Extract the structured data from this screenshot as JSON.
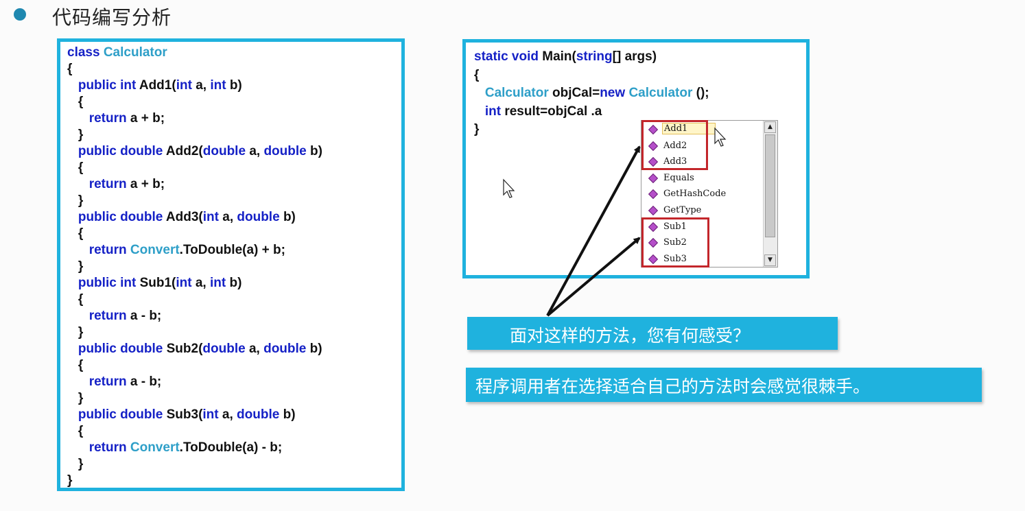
{
  "heading": "代码编写分析",
  "left_code": [
    {
      "segs": [
        [
          "kw",
          "class "
        ],
        [
          "ty",
          "Calculator"
        ]
      ]
    },
    {
      "segs": [
        [
          "",
          "{"
        ]
      ]
    },
    {
      "segs": [
        [
          "",
          "   "
        ],
        [
          "kw",
          "public int "
        ],
        [
          "",
          "Add1("
        ],
        [
          "kw",
          "int "
        ],
        [
          "",
          "a, "
        ],
        [
          "kw",
          "int "
        ],
        [
          "",
          "b)"
        ]
      ]
    },
    {
      "segs": [
        [
          "",
          "   {"
        ]
      ]
    },
    {
      "segs": [
        [
          "",
          "      "
        ],
        [
          "kw",
          "return "
        ],
        [
          "",
          "a + b;"
        ]
      ]
    },
    {
      "segs": [
        [
          "",
          "   }"
        ]
      ]
    },
    {
      "segs": [
        [
          "",
          "   "
        ],
        [
          "kw",
          "public double "
        ],
        [
          "",
          "Add2("
        ],
        [
          "kw",
          "double "
        ],
        [
          "",
          "a, "
        ],
        [
          "kw",
          "double "
        ],
        [
          "",
          "b)"
        ]
      ]
    },
    {
      "segs": [
        [
          "",
          "   {"
        ]
      ]
    },
    {
      "segs": [
        [
          "",
          "      "
        ],
        [
          "kw",
          "return "
        ],
        [
          "",
          "a + b;"
        ]
      ]
    },
    {
      "segs": [
        [
          "",
          "   }"
        ]
      ]
    },
    {
      "segs": [
        [
          "",
          "   "
        ],
        [
          "kw",
          "public double "
        ],
        [
          "",
          "Add3("
        ],
        [
          "kw",
          "int "
        ],
        [
          "",
          "a, "
        ],
        [
          "kw",
          "double "
        ],
        [
          "",
          "b)"
        ]
      ]
    },
    {
      "segs": [
        [
          "",
          "   {"
        ]
      ]
    },
    {
      "segs": [
        [
          "",
          "      "
        ],
        [
          "kw",
          "return "
        ],
        [
          "ty",
          "Convert"
        ],
        [
          "",
          ".ToDouble(a) + b;"
        ]
      ]
    },
    {
      "segs": [
        [
          "",
          "   }"
        ]
      ]
    },
    {
      "segs": [
        [
          "",
          "   "
        ],
        [
          "kw",
          "public int "
        ],
        [
          "",
          "Sub1("
        ],
        [
          "kw",
          "int "
        ],
        [
          "",
          "a, "
        ],
        [
          "kw",
          "int "
        ],
        [
          "",
          "b)"
        ]
      ]
    },
    {
      "segs": [
        [
          "",
          "   {"
        ]
      ]
    },
    {
      "segs": [
        [
          "",
          "      "
        ],
        [
          "kw",
          "return "
        ],
        [
          "",
          "a - b;"
        ]
      ]
    },
    {
      "segs": [
        [
          "",
          "   }"
        ]
      ]
    },
    {
      "segs": [
        [
          "",
          "   "
        ],
        [
          "kw",
          "public double "
        ],
        [
          "",
          "Sub2("
        ],
        [
          "kw",
          "double "
        ],
        [
          "",
          "a, "
        ],
        [
          "kw",
          "double "
        ],
        [
          "",
          "b)"
        ]
      ]
    },
    {
      "segs": [
        [
          "",
          "   {"
        ]
      ]
    },
    {
      "segs": [
        [
          "",
          "      "
        ],
        [
          "kw",
          "return "
        ],
        [
          "",
          "a - b;"
        ]
      ]
    },
    {
      "segs": [
        [
          "",
          "   }"
        ]
      ]
    },
    {
      "segs": [
        [
          "",
          "   "
        ],
        [
          "kw",
          "public double "
        ],
        [
          "",
          "Sub3("
        ],
        [
          "kw",
          "int "
        ],
        [
          "",
          "a, "
        ],
        [
          "kw",
          "double "
        ],
        [
          "",
          "b)"
        ]
      ]
    },
    {
      "segs": [
        [
          "",
          "   {"
        ]
      ]
    },
    {
      "segs": [
        [
          "",
          "      "
        ],
        [
          "kw",
          "return "
        ],
        [
          "ty",
          "Convert"
        ],
        [
          "",
          ".ToDouble(a) - b;"
        ]
      ]
    },
    {
      "segs": [
        [
          "",
          "   }"
        ]
      ]
    },
    {
      "segs": [
        [
          "",
          "}"
        ]
      ]
    }
  ],
  "right_code": [
    {
      "segs": [
        [
          "kw",
          "static void "
        ],
        [
          "",
          "Main("
        ],
        [
          "kw",
          "string"
        ],
        [
          "",
          "[] args)"
        ]
      ]
    },
    {
      "segs": [
        [
          "",
          "{"
        ]
      ]
    },
    {
      "segs": [
        [
          "",
          "   "
        ],
        [
          "ty",
          "Calculator "
        ],
        [
          "",
          "objCal="
        ],
        [
          "kw",
          "new "
        ],
        [
          "ty",
          "Calculator "
        ],
        [
          "",
          "();"
        ]
      ]
    },
    {
      "segs": [
        [
          "",
          "   "
        ],
        [
          "kw",
          "int "
        ],
        [
          "",
          "result=objCal .a"
        ]
      ]
    },
    {
      "segs": [
        [
          "",
          "}"
        ]
      ]
    }
  ],
  "intellisense_items": [
    "Add1",
    "Add2",
    "Add3",
    "Equals",
    "GetHashCode",
    "GetType",
    "Sub1",
    "Sub2",
    "Sub3"
  ],
  "selected_item": "Add1",
  "callout_question": "面对这样的方法，您有何感受？",
  "callout_answer": "程序调用者在选择适合自己的方法时会感觉很棘手。",
  "colors": {
    "accent": "#1fb2de",
    "keyword": "#1521c6",
    "type": "#2e9fc8",
    "highlight": "#c3262b"
  },
  "icons": {
    "member": "method-icon",
    "cursor": "mouse-pointer-icon"
  }
}
